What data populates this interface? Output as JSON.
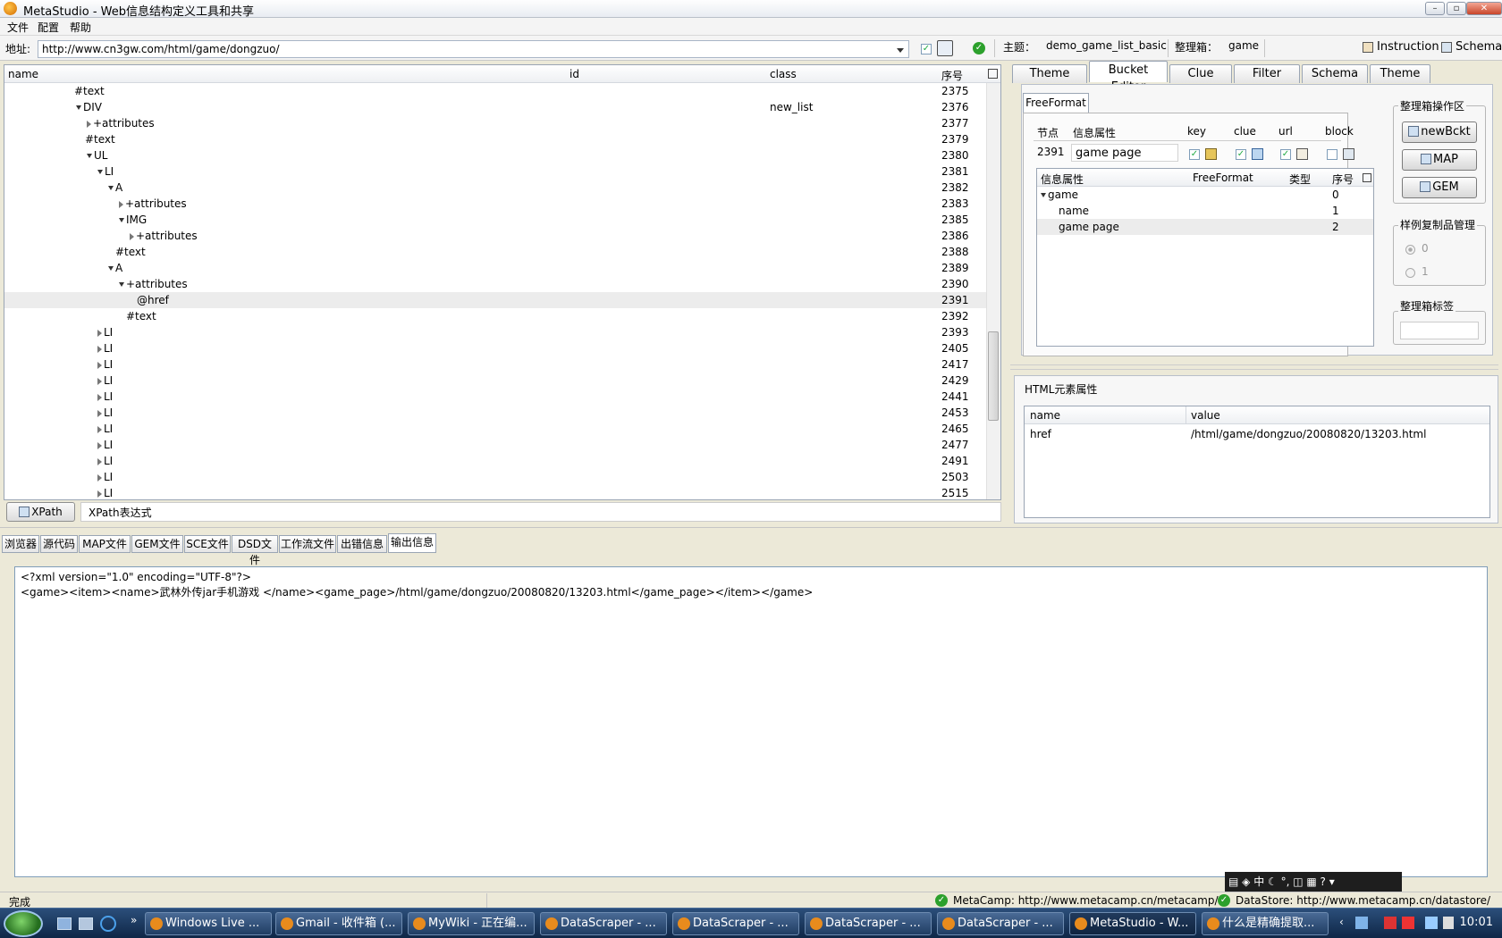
{
  "window": {
    "title": "MetaStudio - Web信息结构定义工具和共享"
  },
  "menu": [
    "文件",
    "配置",
    "帮助"
  ],
  "address": {
    "label": "地址:",
    "url": "http://www.cn3gw.com/html/game/dongzuo/",
    "theme_label": "主题：",
    "theme_value": "demo_game_list_basic",
    "bucket_label": "整理箱：",
    "bucket_value": "game",
    "instruction": "Instruction",
    "schema": "Schema"
  },
  "tree": {
    "headers": {
      "name": "name",
      "id": "id",
      "class": "class",
      "seq": "序号"
    },
    "rows": [
      {
        "name": "#text",
        "indent": 78,
        "tri": "",
        "class": "",
        "seq": "2375"
      },
      {
        "name": "DIV",
        "indent": 80,
        "tri": "down",
        "class": "new_list",
        "seq": "2376"
      },
      {
        "name": "+attributes",
        "indent": 92,
        "tri": "right",
        "class": "",
        "seq": "2377"
      },
      {
        "name": "#text",
        "indent": 90,
        "tri": "",
        "class": "",
        "seq": "2379"
      },
      {
        "name": "UL",
        "indent": 92,
        "tri": "down",
        "class": "",
        "seq": "2380"
      },
      {
        "name": "LI",
        "indent": 104,
        "tri": "down",
        "class": "",
        "seq": "2381"
      },
      {
        "name": "A",
        "indent": 116,
        "tri": "down",
        "class": "",
        "seq": "2382"
      },
      {
        "name": "+attributes",
        "indent": 128,
        "tri": "right",
        "class": "",
        "seq": "2383"
      },
      {
        "name": "IMG",
        "indent": 128,
        "tri": "down",
        "class": "",
        "seq": "2385"
      },
      {
        "name": "+attributes",
        "indent": 140,
        "tri": "right",
        "class": "",
        "seq": "2386"
      },
      {
        "name": "#text",
        "indent": 124,
        "tri": "",
        "class": "",
        "seq": "2388"
      },
      {
        "name": "A",
        "indent": 116,
        "tri": "down",
        "class": "",
        "seq": "2389"
      },
      {
        "name": "+attributes",
        "indent": 128,
        "tri": "down",
        "class": "",
        "seq": "2390"
      },
      {
        "name": "@href",
        "indent": 148,
        "tri": "",
        "class": "",
        "seq": "2391",
        "selected": true
      },
      {
        "name": "#text",
        "indent": 136,
        "tri": "",
        "class": "",
        "seq": "2392"
      },
      {
        "name": "LI",
        "indent": 104,
        "tri": "right",
        "class": "",
        "seq": "2393"
      },
      {
        "name": "LI",
        "indent": 104,
        "tri": "right",
        "class": "",
        "seq": "2405"
      },
      {
        "name": "LI",
        "indent": 104,
        "tri": "right",
        "class": "",
        "seq": "2417"
      },
      {
        "name": "LI",
        "indent": 104,
        "tri": "right",
        "class": "",
        "seq": "2429"
      },
      {
        "name": "LI",
        "indent": 104,
        "tri": "right",
        "class": "",
        "seq": "2441"
      },
      {
        "name": "LI",
        "indent": 104,
        "tri": "right",
        "class": "",
        "seq": "2453"
      },
      {
        "name": "LI",
        "indent": 104,
        "tri": "right",
        "class": "",
        "seq": "2465"
      },
      {
        "name": "LI",
        "indent": 104,
        "tri": "right",
        "class": "",
        "seq": "2477"
      },
      {
        "name": "LI",
        "indent": 104,
        "tri": "right",
        "class": "",
        "seq": "2491"
      },
      {
        "name": "LI",
        "indent": 104,
        "tri": "right",
        "class": "",
        "seq": "2503"
      },
      {
        "name": "LI",
        "indent": 104,
        "tri": "right",
        "class": "",
        "seq": "2515"
      }
    ]
  },
  "xpath": {
    "button": "XPath",
    "placeholder": "XPath表达式"
  },
  "right_tabs": [
    "Theme Editor",
    "Bucket Editor",
    "Clue Editor",
    "Filter Editor",
    "Schema List",
    "Theme List"
  ],
  "bucket": {
    "subtab": "FreeFormat",
    "hdr_node": "节点",
    "hdr_info": "信息属性",
    "hdr_key": "key",
    "hdr_clue": "clue",
    "hdr_url": "url",
    "hdr_block": "block",
    "node_value": "2391",
    "info_value": "game page",
    "grid_headers": {
      "info": "信息属性",
      "ff": "FreeFormat",
      "type": "类型",
      "seq": "序号"
    },
    "grid_rows": [
      {
        "name": "game",
        "seq": "0"
      },
      {
        "name": "name",
        "seq": "1"
      },
      {
        "name": "game page",
        "seq": "2"
      }
    ],
    "ops_title": "整理箱操作区",
    "btn_newbckt": "newBckt",
    "btn_map": "MAP",
    "btn_gem": "GEM",
    "sample_title": "样例复制品管理",
    "radio0": "0",
    "radio1": "1",
    "tag_title": "整理箱标签"
  },
  "html_props": {
    "title": "HTML元素属性",
    "hdr_name": "name",
    "hdr_value": "value",
    "row_name": "href",
    "row_value": "/html/game/dongzuo/20080820/13203.html"
  },
  "bottom_tabs": [
    "浏览器",
    "源代码",
    "MAP文件",
    "GEM文件",
    "SCE文件",
    "DSD文件",
    "工作流文件",
    "出错信息",
    "输出信息"
  ],
  "output": {
    "line1": "<?xml version=\"1.0\" encoding=\"UTF-8\"?>",
    "line2": "<game><item><name>武林外传jar手机游戏 </name><game_page>/html/game/dongzuo/20080820/13203.html</game_page></item></game>"
  },
  "status": {
    "left": "完成",
    "metacamp": "MetaCamp: http://www.metacamp.cn/metacamp/",
    "datastore": "DataStore: http://www.metacamp.cn/datastore/"
  },
  "ime": "中",
  "taskbar": {
    "items": [
      "Windows Live ...",
      "Gmail - 收件箱 (...",
      "MyWiki - 正在编...",
      "DataScraper - ...",
      "DataScraper - ...",
      "DataScraper - ...",
      "DataScraper - ...",
      "MetaStudio - W...",
      "什么是精确提取..."
    ],
    "clock": "10:01"
  }
}
